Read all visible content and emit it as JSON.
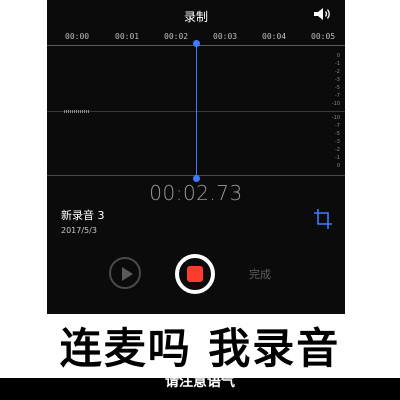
{
  "header": {
    "title": "录制",
    "speaker_icon": "speaker-icon"
  },
  "ruler": {
    "ticks": [
      "00:00",
      "00:01",
      "00:02",
      "00:03",
      "00:04",
      "00:05"
    ]
  },
  "level_scale": [
    "0",
    "-1",
    "-2",
    "-3",
    "-5",
    "-7",
    "-10",
    "-10",
    "-7",
    "-5",
    "-3",
    "-2",
    "-1",
    "0"
  ],
  "playback": {
    "elapsed": "00:02.73"
  },
  "recording": {
    "name": "新录音 3",
    "date": "2017/5/3"
  },
  "controls": {
    "done_label": "完成",
    "play_icon": "play-icon",
    "record_icon": "record-stop-icon",
    "crop_icon": "crop-icon"
  },
  "colors": {
    "background": "#0b0b0b",
    "playhead": "#3f7bff",
    "record": "#ff3b30"
  },
  "caption": {
    "main": "连麦吗 我录音",
    "sub": "请注意语气"
  }
}
